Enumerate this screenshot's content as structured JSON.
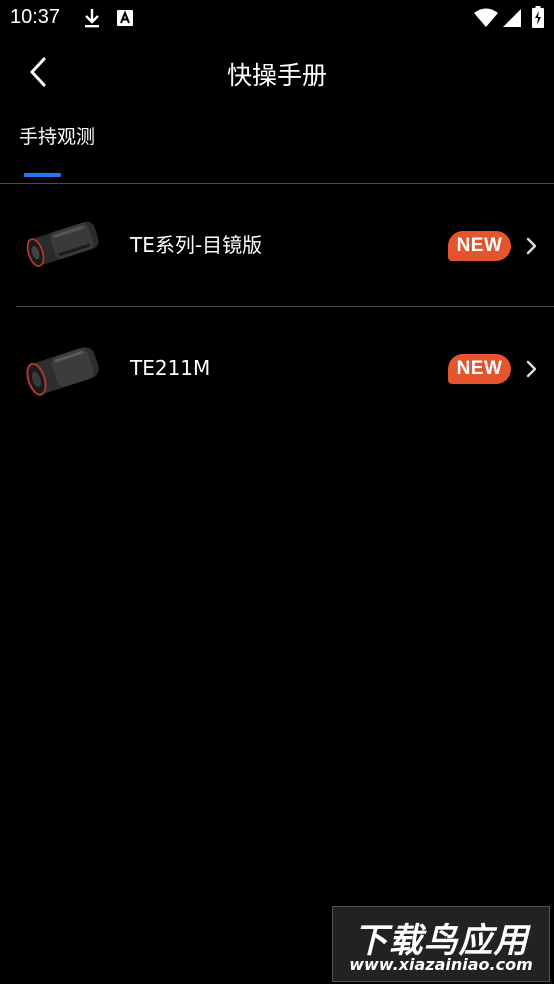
{
  "status_bar": {
    "time": "10:37",
    "icons": [
      "download-icon",
      "font-a-icon",
      "wifi-icon",
      "signal-icon",
      "battery-charging-icon"
    ]
  },
  "header": {
    "title": "快操手册",
    "back_icon": "chevron-left-icon"
  },
  "tabs": [
    {
      "label": "手持观测",
      "selected": true
    }
  ],
  "accent_color": "#1a7cf5",
  "badge_color": "#e4542d",
  "products": [
    {
      "name": "TE系列-目镜版",
      "badge": "NEW",
      "thumb_icon": "thermal-monocular-image"
    },
    {
      "name": "TE211M",
      "badge": "NEW",
      "thumb_icon": "thermal-monocular-image"
    }
  ],
  "watermark": {
    "title": "下载鸟应用",
    "url": "www.xiazainiao.com"
  }
}
